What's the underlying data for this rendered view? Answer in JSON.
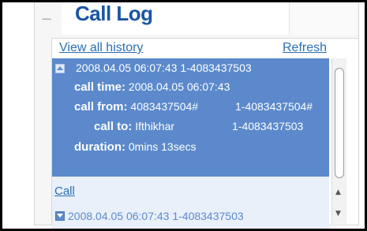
{
  "header": {
    "collapse_symbol": "−",
    "title": "Call Log"
  },
  "links": {
    "view_all": "View all history",
    "refresh": "Refresh"
  },
  "selected_entry": {
    "summary": "2008.04.05 06:07:43 1-4083437503",
    "call_time_label": "call time:",
    "call_time": "2008.04.05 06:07:43",
    "call_from_label": "call from:",
    "call_from_a": "4083437504#",
    "call_from_b": "1-4083437504#",
    "call_to_label": "call to:",
    "call_to_name": "Ifthikhar",
    "call_to_number": "1-4083437503",
    "duration_label": "duration:",
    "duration": "0mins 13secs"
  },
  "call_action": "Call",
  "next_entry": {
    "summary": "2008.04.05 06:07:43 1-4083437503"
  },
  "scroll": {
    "up_arrow": "▲",
    "down_arrow": "▼"
  },
  "colors": {
    "accent": "#1b54a3",
    "selection": "#5b89cc",
    "link": "#2a6fb5"
  }
}
